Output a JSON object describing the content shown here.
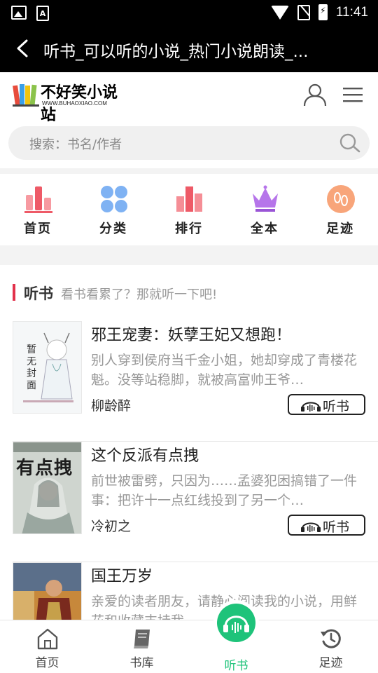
{
  "status_bar": {
    "time": "11:41",
    "a_icon_letter": "A"
  },
  "title_bar": {
    "title": "听书_可以听的小说_热门小说朗读_..."
  },
  "site": {
    "logo_title": "不好笑小说站",
    "logo_url": "WWW.BUHAOXIAO.COM"
  },
  "search": {
    "placeholder": "搜索：书名/作者"
  },
  "categories": [
    {
      "label": "首页",
      "icon": "bar-chart-icon",
      "color": "#f0626e"
    },
    {
      "label": "分类",
      "icon": "grid-dots-icon",
      "color": "#6fa8f2"
    },
    {
      "label": "排行",
      "icon": "ranking-bars-icon",
      "color": "#f0626e"
    },
    {
      "label": "全本",
      "icon": "crown-icon",
      "color": "#b16ae6"
    },
    {
      "label": "足迹",
      "icon": "footprints-icon",
      "color": "#f79a6a"
    }
  ],
  "section": {
    "title": "听书",
    "subtitle": "看书看累了？那就听一下吧!"
  },
  "books": [
    {
      "title": "邪王宠妻：妖孽王妃又想跑！",
      "desc": "别人穿到侯府当千金小姐，她却穿成了青楼花魁。没等站稳脚，就被高富帅王爷…",
      "author": "柳龄醉",
      "listen_label": "听书",
      "cover_text": "暂无封面"
    },
    {
      "title": "这个反派有点拽",
      "desc": "前世被雷劈，只因为……孟婆犯困搞错了一件事：把许十一点红线投到了另一个…",
      "author": "冷初之",
      "listen_label": "听书",
      "cover_text": "有点拽"
    },
    {
      "title": "国王万岁",
      "desc": "亲爱的读者朋友，请静心阅读我的小说，用鲜花和收藏支持我…",
      "author": "",
      "listen_label": "",
      "cover_text": ""
    }
  ],
  "bottom_nav": [
    {
      "label": "首页",
      "icon": "home-icon"
    },
    {
      "label": "书库",
      "icon": "book-icon"
    },
    {
      "label": "听书",
      "icon": "headphones-icon",
      "active": true
    },
    {
      "label": "足迹",
      "icon": "history-icon"
    }
  ],
  "colors": {
    "accent_green": "#1ec37a",
    "section_red": "#e2314b"
  }
}
